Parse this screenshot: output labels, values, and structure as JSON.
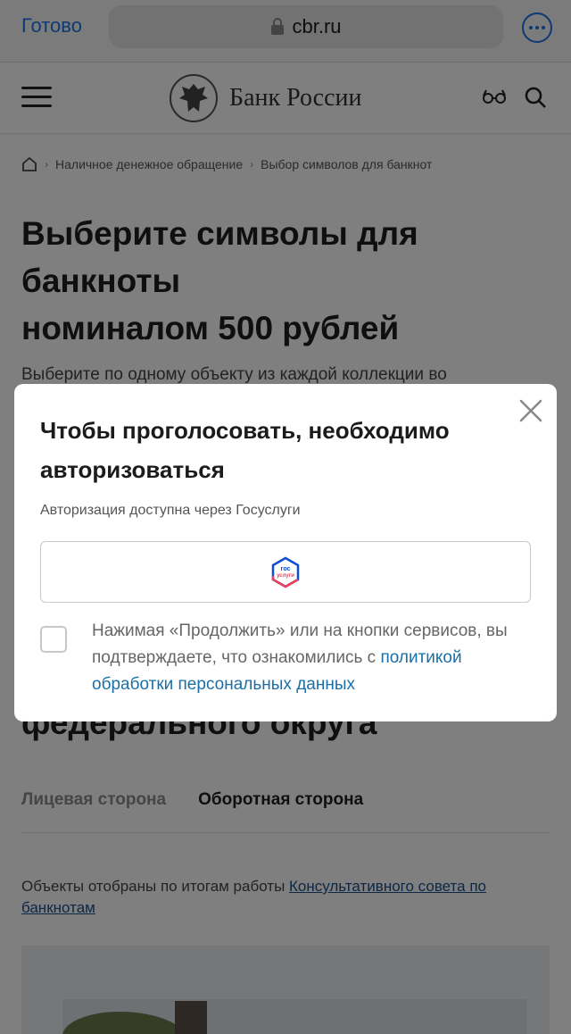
{
  "browser": {
    "done_label": "Готово",
    "url": "cbr.ru"
  },
  "site": {
    "brand_name": "Банк России"
  },
  "breadcrumb": {
    "items": [
      "Наличное денежное обращение",
      "Выбор символов для банкнот"
    ]
  },
  "page": {
    "title_lines": [
      "Выберите символы для",
      "банкноты",
      "номиналом 500 рублей"
    ],
    "intro": "Выберите по одному объекту из каждой коллекции во",
    "region_title": "федерального округа",
    "tabs": [
      "Лицевая сторона",
      "Оборотная сторона"
    ],
    "note_text": "Объекты отобраны по итогам работы ",
    "note_link": "Консультативного совета по банкнотам"
  },
  "modal": {
    "title": "Чтобы проголосовать, необходимо авторизоваться",
    "subtitle": "Авторизация доступна через Госуслуги",
    "gos_logo_text": [
      "гос",
      "услуги"
    ],
    "consent_text": "Нажимая «Продолжить» или на кнопки сервисов, вы подтверждаете, что ознакомились с ",
    "consent_link": "политикой обработки персональных данных",
    "checkbox_checked": false
  },
  "colors": {
    "accent": "#1a73e8",
    "link": "#1a6fa8",
    "gos_red": "#ee3f58",
    "gos_blue": "#0d4cd3"
  }
}
